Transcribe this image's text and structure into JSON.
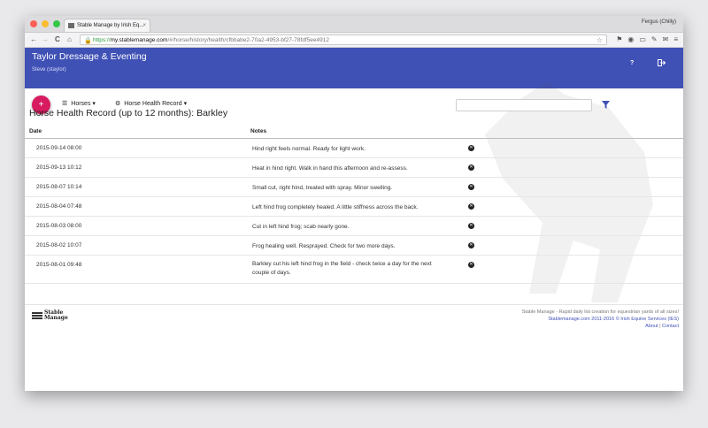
{
  "browser": {
    "tab_title": "Stable Manage by Irish Eq...",
    "tab_close": "×",
    "profile_name": "Fergus (Chilly)",
    "url_scheme": "https://",
    "url_domain": "my.stablemanage.com",
    "url_path": "/#/horse/history/health/cfbbabe2-70a2-4953-bf27-78fdf5ee4912",
    "back": "←",
    "forward": "→",
    "reload": "C",
    "home": "⌂"
  },
  "app": {
    "title": "Taylor Dressage & Eventing",
    "user": "Steve (staylor)",
    "help_label": "?",
    "logout_label": "↦",
    "accent_color": "#3f51b5",
    "fab_color": "#d81b60"
  },
  "toolbar": {
    "add_label": "+",
    "horses_menu": "Horses",
    "record_menu": "Horse Health Record",
    "search_placeholder": ""
  },
  "page": {
    "heading": "Horse Health Record (up to 12 months): Barkley"
  },
  "table": {
    "headers": {
      "date": "Date",
      "notes": "Notes"
    },
    "rows": [
      {
        "date": "2015-09-14 08:00",
        "notes": "Hind right feels normal. Ready for light work."
      },
      {
        "date": "2015-09-13 10:12",
        "notes": "Heat in hind right. Walk in hand this afternoon and re-assess."
      },
      {
        "date": "2015-08-07 10:14",
        "notes": "Small cut, right hind, treated with spray. Minor swelling."
      },
      {
        "date": "2015-08-04 07:48",
        "notes": "Left hind frog completely healed. A little stiffness across the back."
      },
      {
        "date": "2015-08-03 08:00",
        "notes": "Cut in left hind frog; scab nearly gone."
      },
      {
        "date": "2015-08-02 10:07",
        "notes": "Frog healing well. Resprayed. Check for two more days."
      },
      {
        "date": "2015-08-01 09:48",
        "notes": "Barkley cut his left hind frog in the field - check twice a day for the next couple of days."
      }
    ]
  },
  "footer": {
    "logo_line1": "Stable",
    "logo_line2": "Manage",
    "tagline": "Stable Manage - Rapid daily list creation for equestrian yards of all sizes!",
    "copyright": "Stablemanage.com 2011-2016 © Irish Equine Services (IES)",
    "about": "About",
    "separator": "|",
    "contact": "Contact"
  }
}
